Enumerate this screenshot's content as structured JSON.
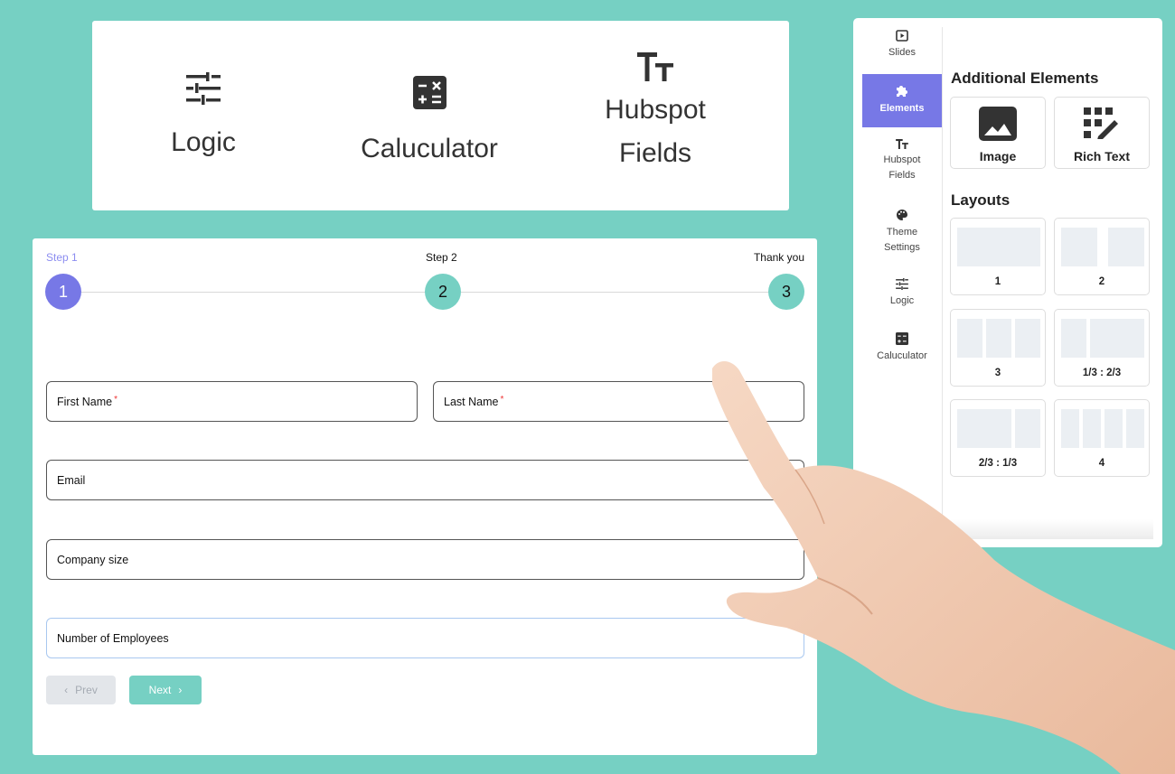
{
  "colors": {
    "background": "#76d0c3",
    "accent_purple": "#7778e6",
    "accent_teal": "#76d0c3"
  },
  "features": [
    {
      "label": "Logic",
      "icon": "sliders-icon"
    },
    {
      "label": "Caluculator",
      "icon": "calculator-icon"
    },
    {
      "label_line1": "Hubspot",
      "label_line2": "Fields",
      "icon": "text-size-icon"
    }
  ],
  "form": {
    "steps": [
      {
        "label": "Step 1",
        "number": "1",
        "active": true
      },
      {
        "label": "Step 2",
        "number": "2"
      },
      {
        "label": "Thank you",
        "number": "3"
      }
    ],
    "fields": {
      "first_name": "First Name",
      "last_name": "Last Name",
      "required_mark": "*",
      "email": "Email",
      "company_size": "Company size",
      "employees": "Number of Employees"
    },
    "prev_label": "Prev",
    "next_label": "Next"
  },
  "panel": {
    "nav": [
      {
        "label": "Slides",
        "icon": "slides-icon"
      },
      {
        "label": "Elements",
        "icon": "puzzle-icon",
        "active": true
      },
      {
        "label_line1": "Hubspot",
        "label_line2": "Fields",
        "icon": "text-size-icon"
      },
      {
        "label_line1": "Theme",
        "label_line2": "Settings",
        "icon": "palette-icon"
      },
      {
        "label": "Logic",
        "icon": "sliders-icon"
      },
      {
        "label": "Caluculator",
        "icon": "calculator-icon"
      }
    ],
    "additional_title": "Additional Elements",
    "elements": [
      {
        "label": "Image",
        "icon": "image-icon"
      },
      {
        "label": "Rich Text",
        "icon": "rich-text-icon"
      }
    ],
    "layouts_title": "Layouts",
    "layouts": [
      "1",
      "2",
      "3",
      "1/3 : 2/3",
      "2/3 : 1/3",
      "4"
    ]
  }
}
